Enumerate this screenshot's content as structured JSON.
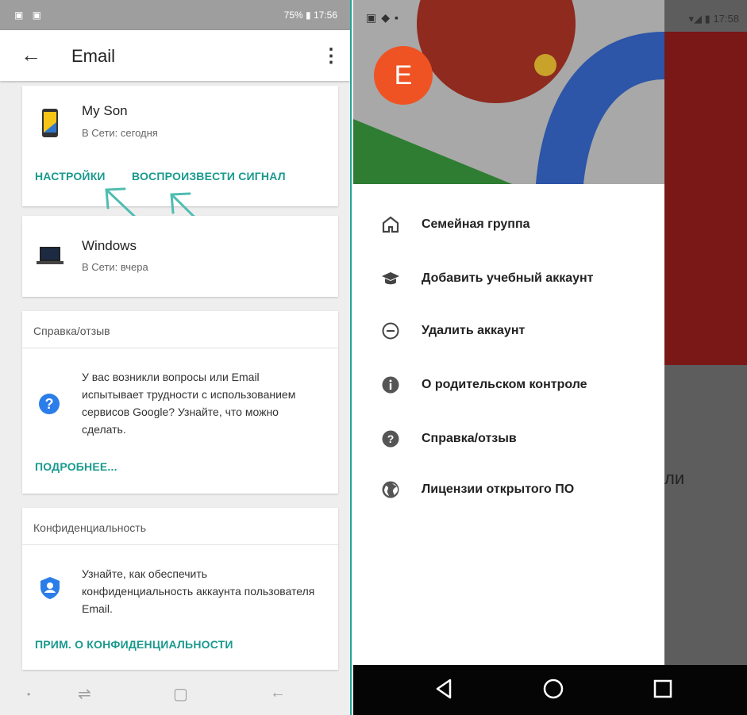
{
  "left": {
    "status": {
      "time": "17:56",
      "battery": "75%"
    },
    "toolbar": {
      "title": "Email"
    },
    "devices": [
      {
        "name": "My Son",
        "status": "В Сети: сегодня"
      },
      {
        "name": "Windows",
        "status": "В Сети: вчера"
      }
    ],
    "device_actions": {
      "settings": "НАСТРОЙКИ",
      "play_sound": "ВОСПРОИЗВЕСТИ СИГНАЛ"
    },
    "help_card": {
      "header": "Справка/отзыв",
      "body": "У вас возникли вопросы или Email испытывает трудности с использованием сервисов Google? Узнайте, что можно сделать.",
      "link": "ПОДРОБНЕЕ..."
    },
    "privacy_card": {
      "header": "Конфиденциальность",
      "body": "Узнайте, как обеспечить конфиденциальность аккаунта пользователя Email.",
      "link": "ПРИМ. О КОНФИДЕНЦИАЛЬНОСТИ"
    }
  },
  "right": {
    "status": {
      "time": "17:58"
    },
    "avatar_letter": "E",
    "background_fragment": "ли",
    "menu": [
      {
        "label": "Семейная группа",
        "icon": "home-icon"
      },
      {
        "label": "Добавить учебный аккаунт",
        "icon": "school-icon"
      },
      {
        "label": "Удалить аккаунт",
        "icon": "remove-circle-icon"
      },
      {
        "label": "О родительском контроле",
        "icon": "info-icon"
      },
      {
        "label": "Справка/отзыв",
        "icon": "help-icon"
      },
      {
        "label": "Лицензии открытого ПО",
        "icon": "globe-icon"
      }
    ]
  },
  "colors": {
    "accent": "#1a9a8e",
    "avatar": "#ef5323",
    "help_icon": "#2b7de9",
    "divider": "#23a39a"
  }
}
